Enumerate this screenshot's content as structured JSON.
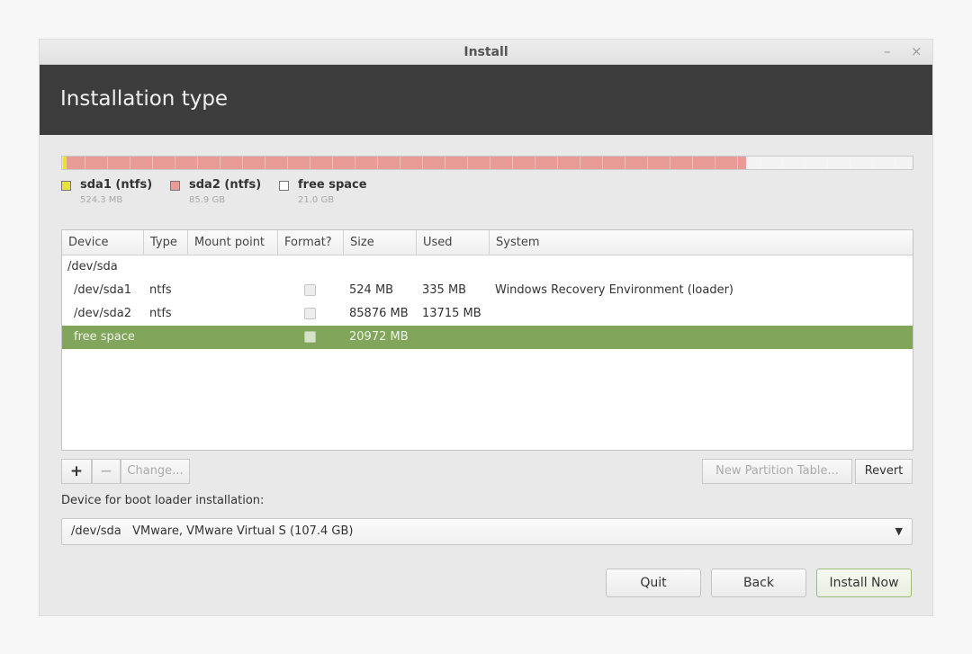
{
  "window": {
    "title": "Install",
    "minimize_glyph": "–",
    "close_glyph": "×"
  },
  "header": {
    "title": "Installation type"
  },
  "colors": {
    "sda1": "#e8e23a",
    "sda2": "#e99b95",
    "free": "#f3f3f3",
    "selection": "#82a55c",
    "header_bg": "#3c3c3c"
  },
  "partition_bar": {
    "segments": [
      {
        "name": "sda1",
        "size_mb": 524.3
      },
      {
        "name": "sda2",
        "size_mb": 85900
      },
      {
        "name": "free",
        "size_mb": 21000
      }
    ]
  },
  "legend": [
    {
      "name": "sda1 (ntfs)",
      "size": "524.3 MB"
    },
    {
      "name": "sda2 (ntfs)",
      "size": "85.9 GB"
    },
    {
      "name": "free space",
      "size": "21.0 GB"
    }
  ],
  "table": {
    "columns": [
      "Device",
      "Type",
      "Mount point",
      "Format?",
      "Size",
      "Used",
      "System"
    ],
    "rows": [
      {
        "device": "/dev/sda",
        "type": "",
        "mount": "",
        "format": false,
        "size": "",
        "used": "",
        "system": "",
        "checkbox": false
      },
      {
        "device": "/dev/sda1",
        "type": "ntfs",
        "mount": "",
        "format": false,
        "size": "524 MB",
        "used": "335 MB",
        "system": "Windows Recovery Environment (loader)",
        "checkbox": true
      },
      {
        "device": "/dev/sda2",
        "type": "ntfs",
        "mount": "",
        "format": false,
        "size": "85876 MB",
        "used": "13715 MB",
        "system": "",
        "checkbox": true
      },
      {
        "device": "free space",
        "type": "",
        "mount": "",
        "format": false,
        "size": "20972 MB",
        "used": "",
        "system": "",
        "checkbox": true,
        "selected": true
      }
    ]
  },
  "toolbar": {
    "add_label": "+",
    "remove_label": "−",
    "change_label": "Change...",
    "new_table_label": "New Partition Table...",
    "revert_label": "Revert"
  },
  "bootloader": {
    "label": "Device for boot loader installation:",
    "value": "/dev/sda   VMware, VMware Virtual S (107.4 GB)"
  },
  "buttons": {
    "quit": "Quit",
    "back": "Back",
    "install": "Install Now"
  }
}
